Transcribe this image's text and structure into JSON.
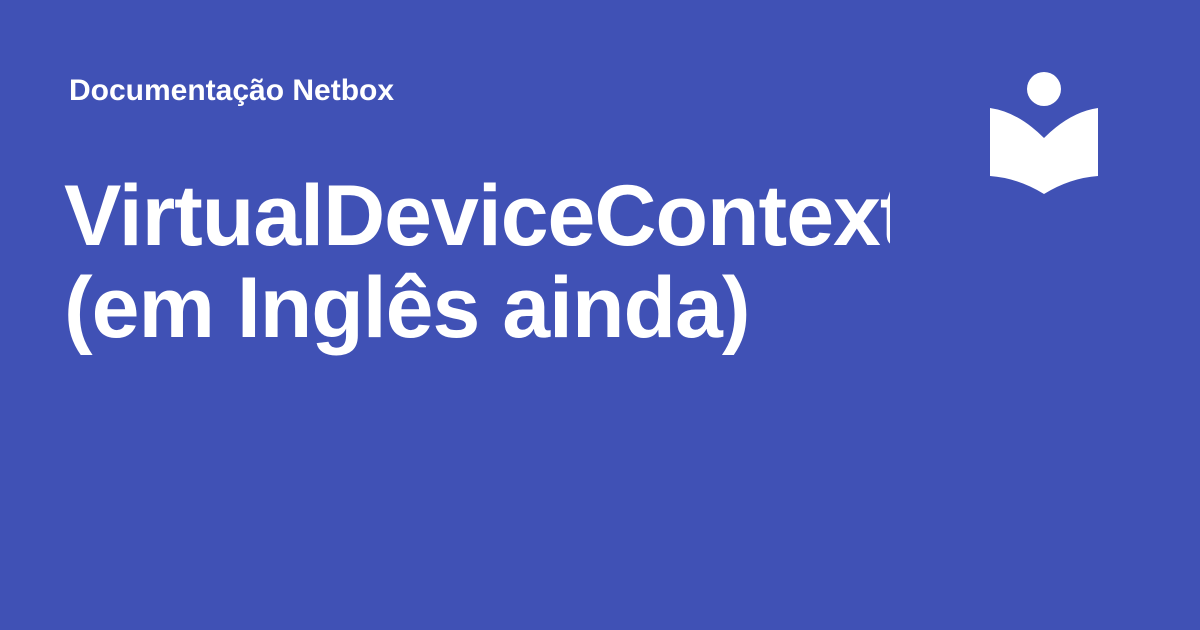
{
  "social_card": {
    "site_name": "Documentação Netbox",
    "title_line_1": "VirtualDeviceContext",
    "title_line_2": "(em Inglês ainda)",
    "logo_icon": "reader-book-icon",
    "colors": {
      "background": "#4051b5",
      "text": "#ffffff"
    }
  }
}
